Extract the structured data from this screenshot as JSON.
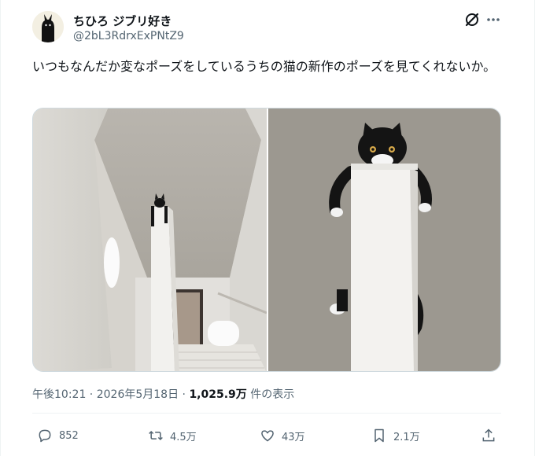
{
  "author": {
    "display_name": "ちひろ ジブリ好き",
    "handle": "@2bL3RdrxExPNtZ9"
  },
  "tweet": {
    "text": "いつもなんだか変なポーズをしているうちの猫の新作のポーズを見てくれないか。"
  },
  "meta": {
    "time": "午後10:21",
    "sep1": " · ",
    "date": "2026年5月18日",
    "sep2": " · ",
    "views_count": "1,025.9万",
    "views_label": " 件の表示"
  },
  "actions": {
    "replies": "852",
    "reposts": "4.5万",
    "likes": "43万",
    "bookmarks": "2.1万"
  },
  "icons": [
    "grok-icon",
    "more-icon",
    "reply-icon",
    "repost-icon",
    "like-icon",
    "bookmark-icon",
    "share-icon"
  ],
  "colors": {
    "text_primary": "#0f1419",
    "text_secondary": "#536471",
    "border": "#cfd9de"
  }
}
